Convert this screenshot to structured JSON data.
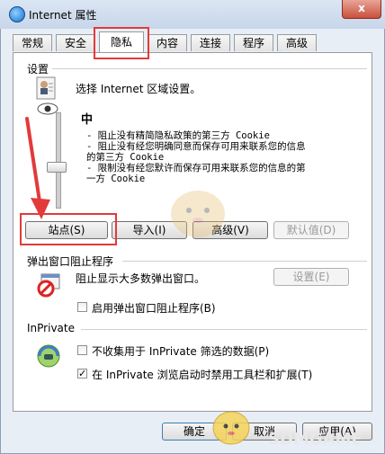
{
  "window": {
    "title": "Internet 属性",
    "close_glyph": "x"
  },
  "tabs": [
    {
      "label": "常规"
    },
    {
      "label": "安全"
    },
    {
      "label": "隐私"
    },
    {
      "label": "内容"
    },
    {
      "label": "连接"
    },
    {
      "label": "程序"
    },
    {
      "label": "高级"
    }
  ],
  "settings": {
    "group_label": "设置",
    "zone_prompt": "选择 Internet 区域设置。",
    "level_name": "中",
    "desc_lines": [
      "- 阻止没有精简隐私政策的第三方 Cookie",
      "- 阻止没有经您明确同意而保存可用来联系您的信息",
      "的第三方 Cookie",
      "- 限制没有经您默许而保存可用来联系您的信息的第",
      "一方 Cookie"
    ],
    "buttons": {
      "sites": "站点(S)",
      "import": "导入(I)",
      "advanced": "高级(V)",
      "default": "默认值(D)"
    }
  },
  "popup_blocker": {
    "group_label": "弹出窗口阻止程序",
    "description": "阻止显示大多数弹出窗口。",
    "settings_button": "设置(E)",
    "enable_label": "启用弹出窗口阻止程序(B)",
    "enable_checked": false
  },
  "inprivate": {
    "group_label": "InPrivate",
    "option1_label": "不收集用于 InPrivate 筛选的数据(P)",
    "option1_checked": false,
    "option2_label": "在 InPrivate 浏览启动时禁用工具栏和扩展(T)",
    "option2_checked": true
  },
  "footer": {
    "ok": "确定",
    "cancel": "取消",
    "apply": "应用(A)"
  },
  "watermark": {
    "text": "SDMGAME"
  },
  "checkmark": "✓"
}
